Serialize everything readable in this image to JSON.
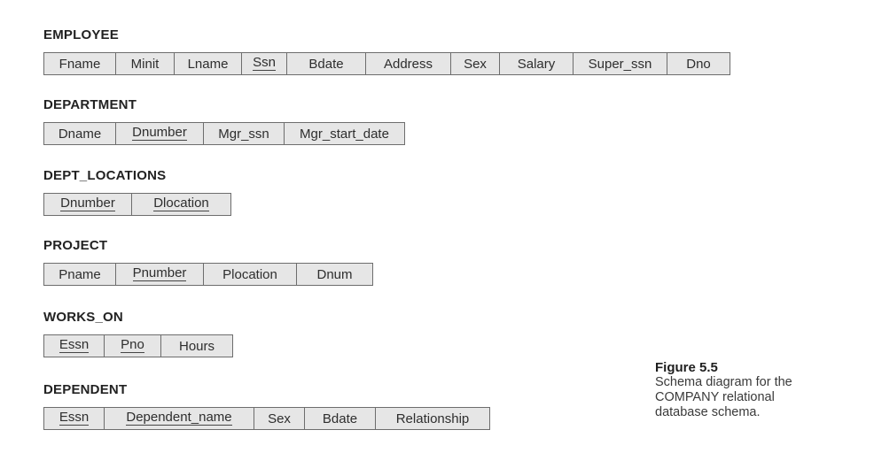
{
  "relations": [
    {
      "name": "EMPLOYEE",
      "attributes": [
        {
          "label": "Fname",
          "pk": false
        },
        {
          "label": "Minit",
          "pk": false
        },
        {
          "label": "Lname",
          "pk": false
        },
        {
          "label": "Ssn",
          "pk": true
        },
        {
          "label": "Bdate",
          "pk": false
        },
        {
          "label": "Address",
          "pk": false
        },
        {
          "label": "Sex",
          "pk": false
        },
        {
          "label": "Salary",
          "pk": false
        },
        {
          "label": "Super_ssn",
          "pk": false
        },
        {
          "label": "Dno",
          "pk": false
        }
      ]
    },
    {
      "name": "DEPARTMENT",
      "attributes": [
        {
          "label": "Dname",
          "pk": false
        },
        {
          "label": "Dnumber",
          "pk": true
        },
        {
          "label": "Mgr_ssn",
          "pk": false
        },
        {
          "label": "Mgr_start_date",
          "pk": false
        }
      ]
    },
    {
      "name": "DEPT_LOCATIONS",
      "attributes": [
        {
          "label": "Dnumber",
          "pk": true
        },
        {
          "label": "Dlocation",
          "pk": true
        }
      ]
    },
    {
      "name": "PROJECT",
      "attributes": [
        {
          "label": "Pname",
          "pk": false
        },
        {
          "label": "Pnumber",
          "pk": true
        },
        {
          "label": "Plocation",
          "pk": false
        },
        {
          "label": "Dnum",
          "pk": false
        }
      ]
    },
    {
      "name": "WORKS_ON",
      "attributes": [
        {
          "label": "Essn",
          "pk": true
        },
        {
          "label": "Pno",
          "pk": true
        },
        {
          "label": "Hours",
          "pk": false
        }
      ]
    },
    {
      "name": "DEPENDENT",
      "attributes": [
        {
          "label": "Essn",
          "pk": true
        },
        {
          "label": "Dependent_name",
          "pk": true
        },
        {
          "label": "Sex",
          "pk": false
        },
        {
          "label": "Bdate",
          "pk": false
        },
        {
          "label": "Relationship",
          "pk": false
        }
      ]
    }
  ],
  "caption": {
    "figure_label": "Figure 5.5",
    "lines": [
      "Schema diagram for the",
      "COMPANY relational",
      "database schema."
    ]
  }
}
